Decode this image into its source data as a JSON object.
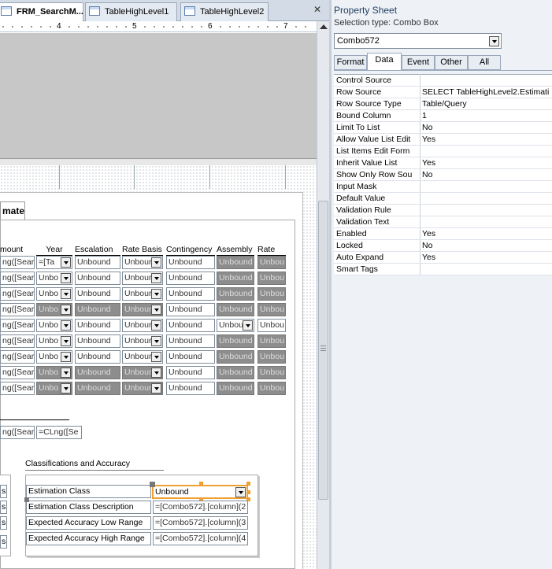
{
  "tabs": [
    {
      "label": "FRM_SearchM...",
      "active": true
    },
    {
      "label": "TableHighLevel1",
      "active": false
    },
    {
      "label": "TableHighLevel2",
      "active": false
    }
  ],
  "tabs_close": "✕",
  "ruler_marks": [
    "4",
    "5",
    "6",
    "7"
  ],
  "section_tab_label": "mate",
  "columns": [
    "mount",
    "Year",
    "Escalation",
    "Rate Basis",
    "Contingency",
    "Assembly",
    "Rate"
  ],
  "rows": [
    {
      "amount": "ng([Sear",
      "year": "=[Ta",
      "escalation": "Unbound",
      "rate_basis": "Unbour",
      "contingency": "Unbound",
      "assembly": "Unbound",
      "rate": "Unbou",
      "style": "year-white"
    },
    {
      "amount": "ng([Sear",
      "year": "Unbo",
      "escalation": "Unbound",
      "rate_basis": "Unbour",
      "contingency": "Unbound",
      "assembly": "Unbound",
      "rate": "Unbou",
      "style": "normal"
    },
    {
      "amount": "ng([Sear",
      "year": "Unbo",
      "escalation": "Unbound",
      "rate_basis": "Unbour",
      "contingency": "Unbound",
      "assembly": "Unbound",
      "rate": "Unbou",
      "style": "normal"
    },
    {
      "amount": "ng([Sear",
      "year": "Unbo",
      "escalation": "Unbound",
      "rate_basis": "Unbour",
      "contingency": "Unbound",
      "assembly": "Unbound",
      "rate": "Unbou",
      "style": "alldark"
    },
    {
      "amount": "ng([Sear",
      "year": "Unbo",
      "escalation": "Unbound",
      "rate_basis": "Unbour",
      "contingency": "Unbound",
      "assembly": "Unbou",
      "rate": "Unbou",
      "style": "assembly-white"
    },
    {
      "amount": "ng([Sear",
      "year": "Unbo",
      "escalation": "Unbound",
      "rate_basis": "Unbour",
      "contingency": "Unbound",
      "assembly": "Unbound",
      "rate": "Unbou",
      "style": "normal"
    },
    {
      "amount": "ng([Sear",
      "year": "Unbo",
      "escalation": "Unbound",
      "rate_basis": "Unbour",
      "contingency": "Unbound",
      "assembly": "Unbound",
      "rate": "Unbou",
      "style": "normal"
    },
    {
      "amount": "ng([Sear",
      "year": "Unbo",
      "escalation": "Unbound",
      "rate_basis": "Unbour",
      "contingency": "Unbound",
      "assembly": "Unbound",
      "rate": "Unbou",
      "style": "alldark"
    },
    {
      "amount": "ng([Sear",
      "year": "Unbo",
      "escalation": "Unbound",
      "rate_basis": "Unbour",
      "contingency": "Unbound",
      "assembly": "Unbound",
      "rate": "Unbou",
      "style": "alldark"
    }
  ],
  "totals": [
    "ng([Sear",
    "=CLng([Se"
  ],
  "classifications_title": "Classifications and Accuracy",
  "classifications": [
    {
      "label": "Estimation Class",
      "value": "Unbound"
    },
    {
      "label": "Estimation Class Description",
      "value": "=[Combo572].[column](2"
    },
    {
      "label": "Expected Accuracy Low Range",
      "value": "=[Combo572].[column](3"
    },
    {
      "label": "Expected Accuracy High Range",
      "value": "=[Combo572].[column](4"
    }
  ],
  "left_stub": [
    "s",
    "s",
    "s",
    "s"
  ],
  "property_sheet": {
    "title": "Property Sheet",
    "selection_type": "Selection type:  Combo Box",
    "selected_control": "Combo572",
    "tabs": [
      {
        "label": "Format",
        "active": false
      },
      {
        "label": "Data",
        "active": true
      },
      {
        "label": "Event",
        "active": false
      },
      {
        "label": "Other",
        "active": false
      },
      {
        "label": "All",
        "active": false
      }
    ],
    "properties": [
      {
        "name": "Control Source",
        "value": ""
      },
      {
        "name": "Row Source",
        "value": "SELECT TableHighLevel2.Estimati"
      },
      {
        "name": "Row Source Type",
        "value": "Table/Query"
      },
      {
        "name": "Bound Column",
        "value": "1"
      },
      {
        "name": "Limit To List",
        "value": "No"
      },
      {
        "name": "Allow Value List Edit",
        "value": "Yes"
      },
      {
        "name": "List Items Edit Form",
        "value": ""
      },
      {
        "name": "Inherit Value List",
        "value": "Yes"
      },
      {
        "name": "Show Only Row Sou",
        "value": "No"
      },
      {
        "name": "Input Mask",
        "value": ""
      },
      {
        "name": "Default Value",
        "value": ""
      },
      {
        "name": "Validation Rule",
        "value": ""
      },
      {
        "name": "Validation Text",
        "value": ""
      },
      {
        "name": "Enabled",
        "value": "Yes"
      },
      {
        "name": "Locked",
        "value": "No"
      },
      {
        "name": "Auto Expand",
        "value": "Yes"
      },
      {
        "name": "Smart Tags",
        "value": ""
      }
    ]
  }
}
